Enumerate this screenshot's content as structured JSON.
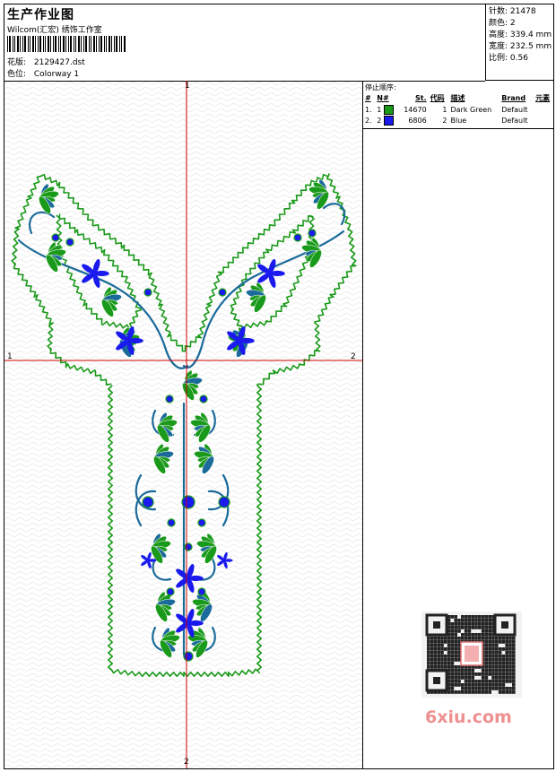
{
  "header": {
    "title": "生产作业图",
    "company": "Wilcom(汇宏) 绣饰工作室",
    "design_label": "花版:",
    "design_value": "2129427.dst",
    "color_label": "色位:",
    "color_value": "Colorway 1"
  },
  "stats": {
    "stitches_label": "针数:",
    "stitches_value": "21478",
    "colors_label": "颜色:",
    "colors_value": "2",
    "height_label": "高度:",
    "height_value": "339.4 mm",
    "width_label": "宽度:",
    "width_value": "232.5 mm",
    "scale_label": "比例:",
    "scale_value": "0.56"
  },
  "stop_sequence": {
    "title": "停止顺序:",
    "columns": [
      "#",
      "N#",
      "St.",
      "代码",
      "描述",
      "Brand",
      "元素"
    ],
    "rows": [
      {
        "index": "1.",
        "needle": "1",
        "color": "#1a9a1a",
        "stitches": "14670",
        "code": "1",
        "description": "Dark Green",
        "brand": "Default"
      },
      {
        "index": "2.",
        "needle": "2",
        "color": "#1a1aee",
        "stitches": "6806",
        "code": "2",
        "description": "Blue",
        "brand": "Default"
      }
    ]
  },
  "axes": {
    "top_label": "1",
    "left_label": "1",
    "right_label": "2",
    "bottom_label": "2"
  },
  "colors": {
    "green": "#1a9a1a",
    "blue": "#1a1aee",
    "teal": "#1a6a9a",
    "axis": "#cc0000"
  },
  "watermark": {
    "logo_text": "6xiu.com"
  }
}
